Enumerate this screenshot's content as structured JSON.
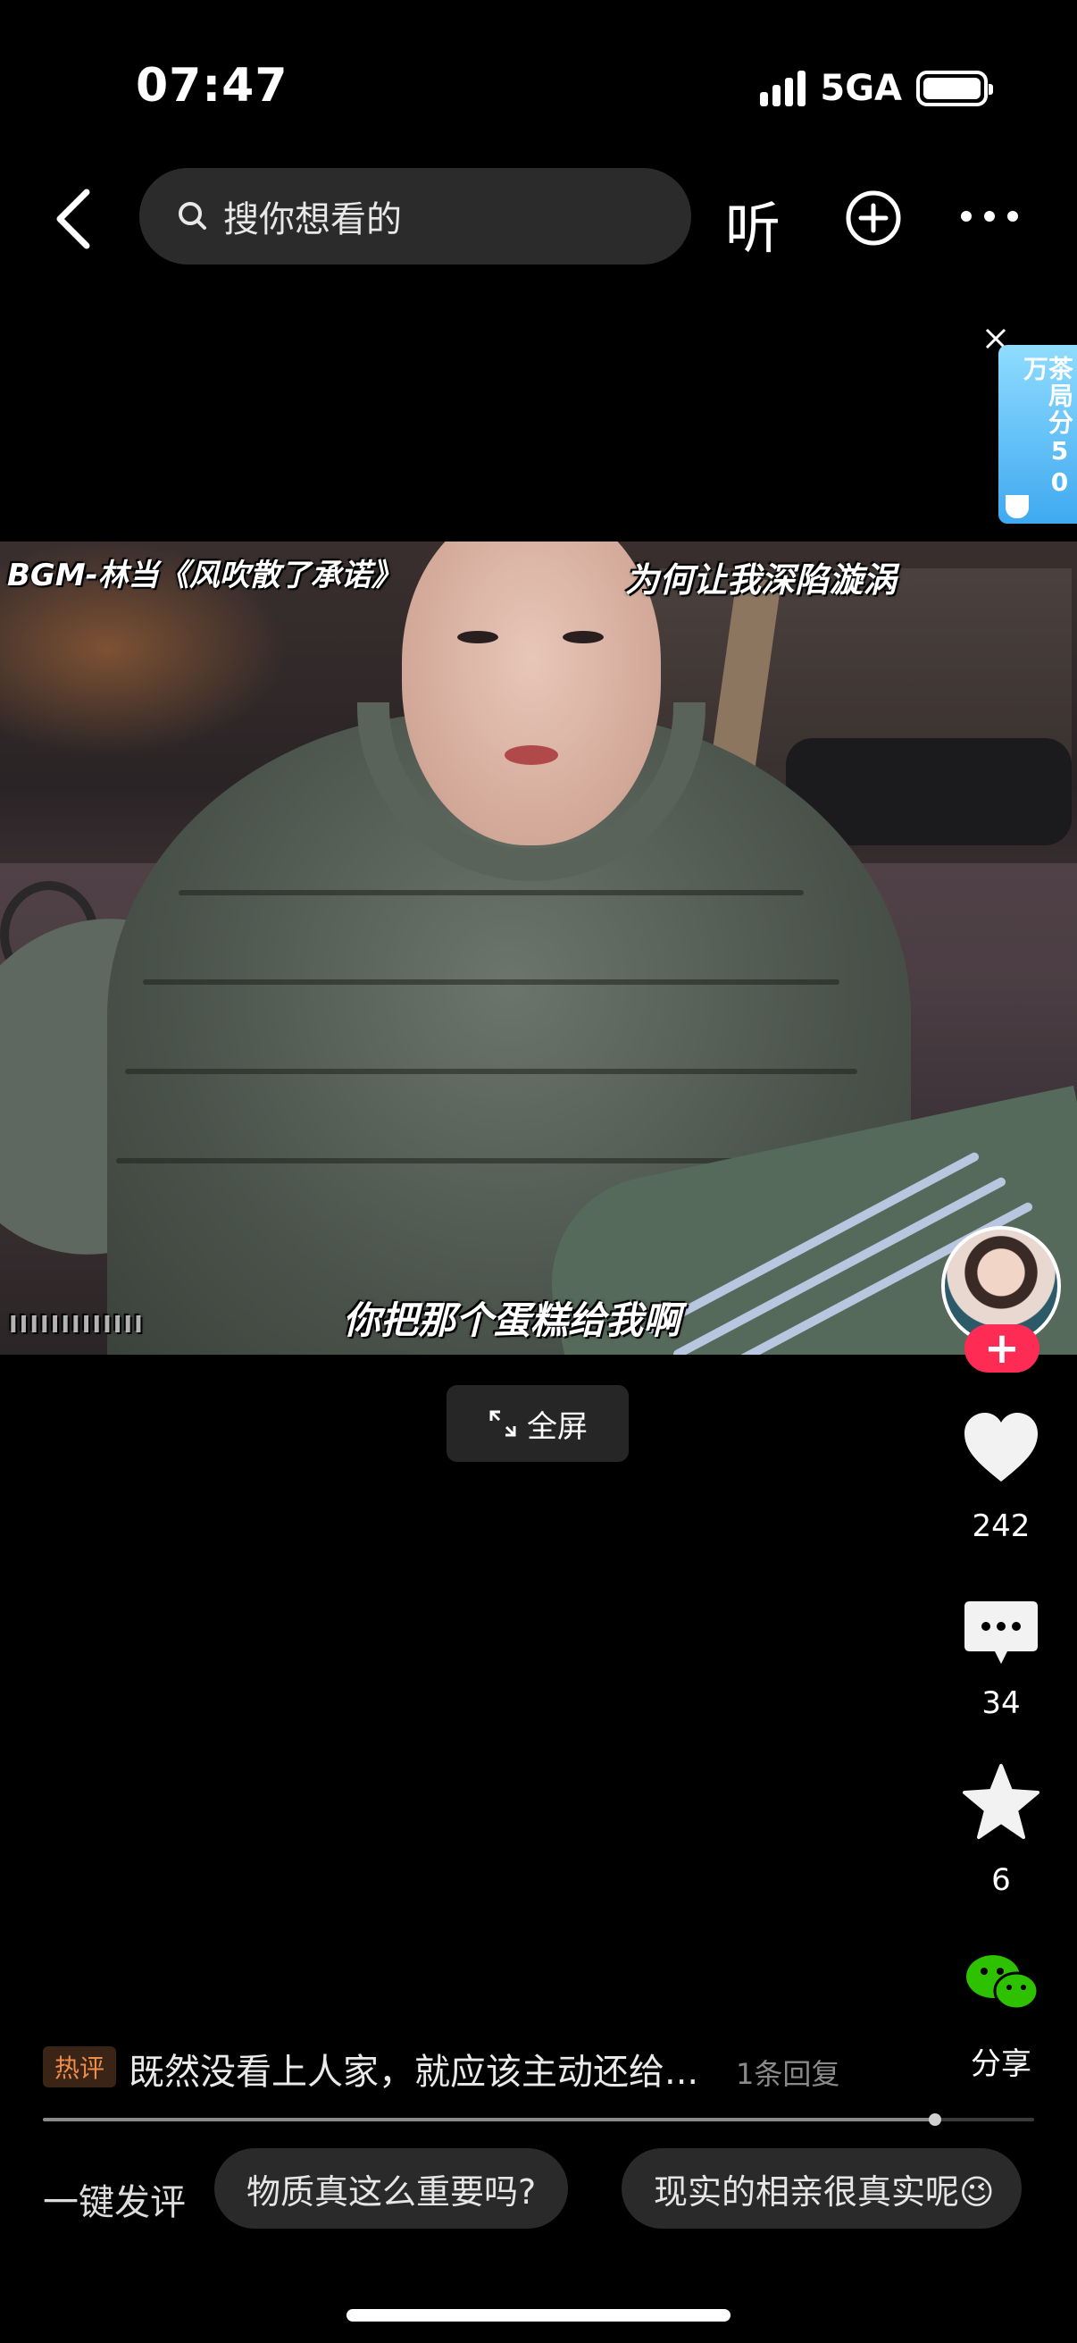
{
  "status_bar": {
    "time": "07:47",
    "network": "5GA",
    "battery_level": 1.0
  },
  "top_nav": {
    "search_placeholder": "搜你想看的",
    "listen_label": "听"
  },
  "ad": {
    "text": "茶局分50万"
  },
  "video": {
    "bgm_overlay": "BGM-林当《风吹散了承诺》",
    "lyric_overlay": "为何让我深陷漩涡",
    "subtitle": "你把那个蛋糕给我啊",
    "watermark": "IIIIIIIIIIIII",
    "fullscreen_label": "全屏"
  },
  "actions": {
    "likes": "242",
    "comments": "34",
    "favorites": "6",
    "share_label": "分享"
  },
  "hot_comment": {
    "tag": "热评",
    "text": "既然没看上人家，就应该主动还给...",
    "replies": "1条回复"
  },
  "playback": {
    "progress": 0.9
  },
  "quick_comment": {
    "label": "一键发评",
    "chips": [
      "物质真这么重要吗?",
      "现实的相亲很真实呢😉"
    ]
  },
  "colors": {
    "follow_accent": "#fe2c55",
    "hot_tag": "#f08c4a",
    "wechat_green": "#2dc100"
  }
}
